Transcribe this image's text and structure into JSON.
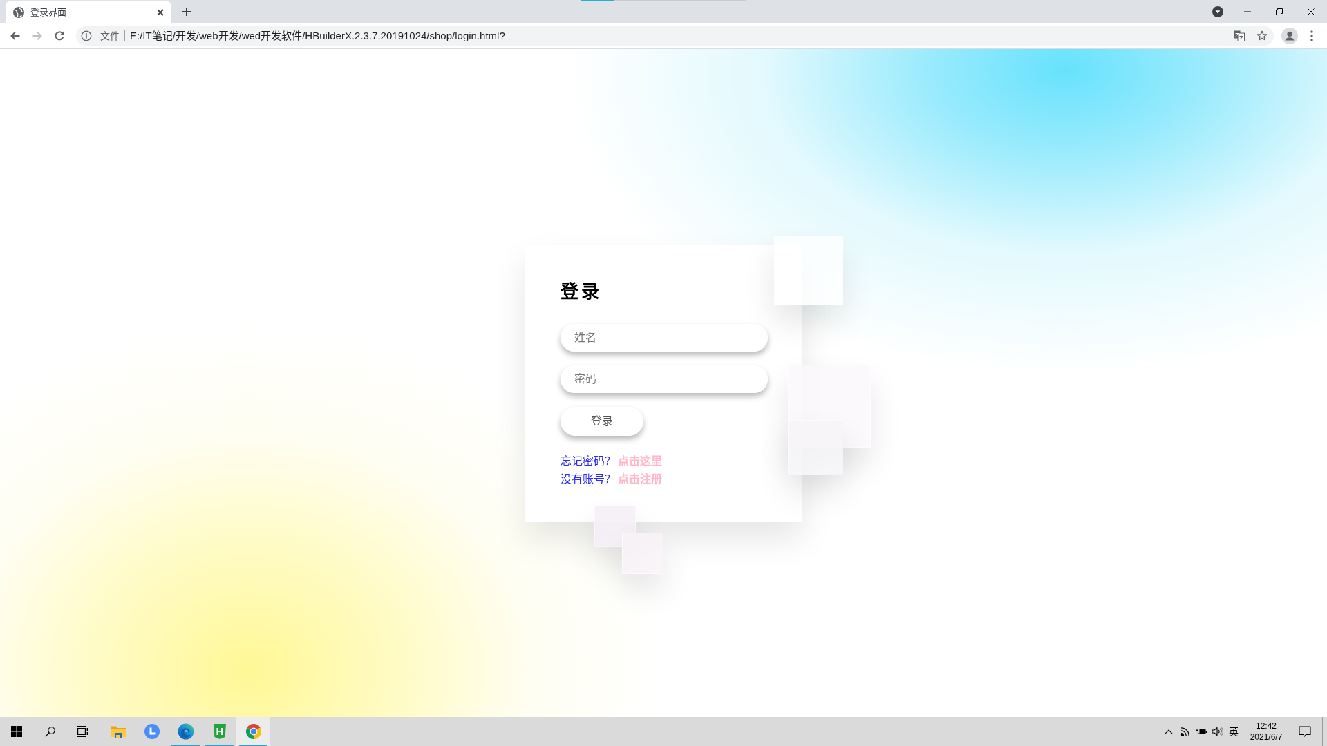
{
  "browser": {
    "loading_bar": {
      "level": 0.2
    },
    "tabs": [
      {
        "title": "登录界面",
        "selected": true
      }
    ],
    "nav_buttons": [
      {
        "kind": "back",
        "disabled": false
      },
      {
        "kind": "forward",
        "disabled": true
      },
      {
        "kind": "reload",
        "disabled": false
      }
    ],
    "address_bar": {
      "scheme": "文件",
      "url": "E:/IT笔记/开发/web开发/wed开发软件/HBuilderX.2.3.7.20191024/shop/login.html?"
    }
  },
  "login_card": {
    "title": "登录",
    "fields": [
      {
        "placeholder": "姓名"
      },
      {
        "placeholder": "密码"
      }
    ],
    "submit_button": "登录",
    "links": [
      {
        "prompt": "忘记密码？",
        "link": "点击这里"
      },
      {
        "prompt": "没有账号？",
        "link": "点击注册"
      }
    ]
  },
  "taskbar": {
    "apps": [
      {
        "kind": "folder",
        "running": false,
        "selected": false
      },
      {
        "kind": "clock",
        "running": false,
        "selected": false
      },
      {
        "kind": "swirl",
        "running": true,
        "selected": false
      },
      {
        "kind": "letter_tile",
        "label": "H",
        "running": true,
        "selected": false
      },
      {
        "kind": "browser",
        "running": true,
        "selected": true
      }
    ],
    "tray": {
      "input_method": "英",
      "time": "12:42",
      "date": "2021/6/7"
    }
  }
}
